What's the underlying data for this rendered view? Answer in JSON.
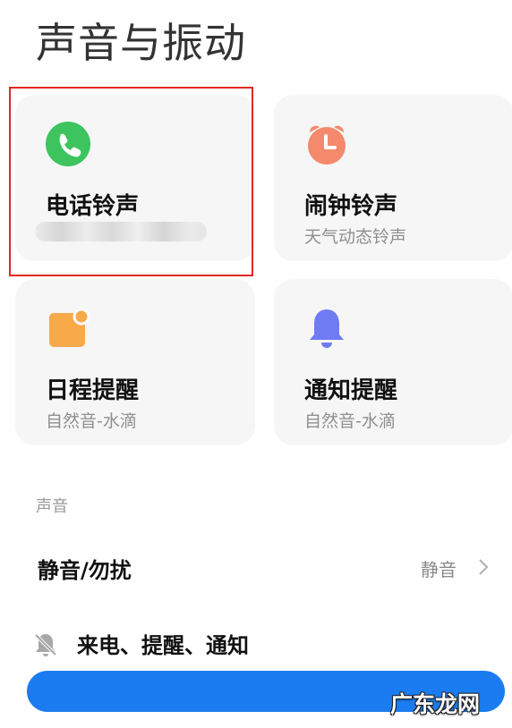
{
  "page": {
    "title": "声音与振动"
  },
  "cards": {
    "ringtone": {
      "title": "电话铃声",
      "subtitle": "",
      "icon": "phone-icon",
      "color": "#3dc45f"
    },
    "alarm": {
      "title": "闹钟铃声",
      "subtitle": "天气动态铃声",
      "icon": "alarm-clock-icon",
      "color": "#f5896b"
    },
    "calendar": {
      "title": "日程提醒",
      "subtitle": "自然音-水滴",
      "icon": "calendar-icon",
      "color": "#f8a94a"
    },
    "notification": {
      "title": "通知提醒",
      "subtitle": "自然音-水滴",
      "icon": "bell-icon",
      "color": "#6f7bf2"
    }
  },
  "sound_section": {
    "label": "声音",
    "silent_row": {
      "label": "静音/勿扰",
      "value": "静音"
    },
    "mute_row": {
      "label": "来电、提醒、通知",
      "icon": "bell-off-icon"
    }
  },
  "watermark": {
    "text": "广东龙网"
  },
  "colors": {
    "highlight": "#e0281f",
    "accent_blue": "#1a7cf0"
  }
}
